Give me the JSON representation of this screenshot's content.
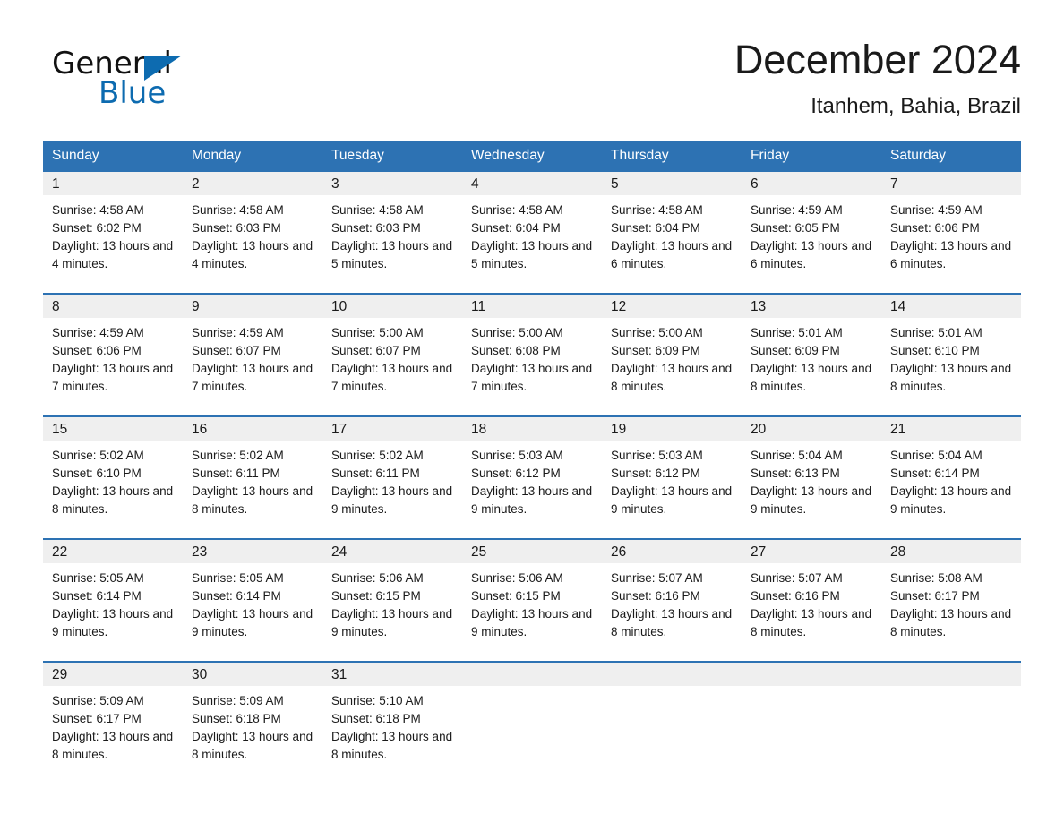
{
  "brand": {
    "logo_primary": "General",
    "logo_secondary": "Blue",
    "logo_triangle_icon": "triangle-icon",
    "accent_color": "#0d6bb0"
  },
  "header": {
    "title": "December 2024",
    "location": "Itanhem, Bahia, Brazil"
  },
  "calendar": {
    "header_color": "#2d72b3",
    "day_band_color": "#efefef",
    "weekdays": [
      "Sunday",
      "Monday",
      "Tuesday",
      "Wednesday",
      "Thursday",
      "Friday",
      "Saturday"
    ],
    "weeks": [
      [
        {
          "day": "1",
          "sunrise": "Sunrise: 4:58 AM",
          "sunset": "Sunset: 6:02 PM",
          "daylight": "Daylight: 13 hours and 4 minutes."
        },
        {
          "day": "2",
          "sunrise": "Sunrise: 4:58 AM",
          "sunset": "Sunset: 6:03 PM",
          "daylight": "Daylight: 13 hours and 4 minutes."
        },
        {
          "day": "3",
          "sunrise": "Sunrise: 4:58 AM",
          "sunset": "Sunset: 6:03 PM",
          "daylight": "Daylight: 13 hours and 5 minutes."
        },
        {
          "day": "4",
          "sunrise": "Sunrise: 4:58 AM",
          "sunset": "Sunset: 6:04 PM",
          "daylight": "Daylight: 13 hours and 5 minutes."
        },
        {
          "day": "5",
          "sunrise": "Sunrise: 4:58 AM",
          "sunset": "Sunset: 6:04 PM",
          "daylight": "Daylight: 13 hours and 6 minutes."
        },
        {
          "day": "6",
          "sunrise": "Sunrise: 4:59 AM",
          "sunset": "Sunset: 6:05 PM",
          "daylight": "Daylight: 13 hours and 6 minutes."
        },
        {
          "day": "7",
          "sunrise": "Sunrise: 4:59 AM",
          "sunset": "Sunset: 6:06 PM",
          "daylight": "Daylight: 13 hours and 6 minutes."
        }
      ],
      [
        {
          "day": "8",
          "sunrise": "Sunrise: 4:59 AM",
          "sunset": "Sunset: 6:06 PM",
          "daylight": "Daylight: 13 hours and 7 minutes."
        },
        {
          "day": "9",
          "sunrise": "Sunrise: 4:59 AM",
          "sunset": "Sunset: 6:07 PM",
          "daylight": "Daylight: 13 hours and 7 minutes."
        },
        {
          "day": "10",
          "sunrise": "Sunrise: 5:00 AM",
          "sunset": "Sunset: 6:07 PM",
          "daylight": "Daylight: 13 hours and 7 minutes."
        },
        {
          "day": "11",
          "sunrise": "Sunrise: 5:00 AM",
          "sunset": "Sunset: 6:08 PM",
          "daylight": "Daylight: 13 hours and 7 minutes."
        },
        {
          "day": "12",
          "sunrise": "Sunrise: 5:00 AM",
          "sunset": "Sunset: 6:09 PM",
          "daylight": "Daylight: 13 hours and 8 minutes."
        },
        {
          "day": "13",
          "sunrise": "Sunrise: 5:01 AM",
          "sunset": "Sunset: 6:09 PM",
          "daylight": "Daylight: 13 hours and 8 minutes."
        },
        {
          "day": "14",
          "sunrise": "Sunrise: 5:01 AM",
          "sunset": "Sunset: 6:10 PM",
          "daylight": "Daylight: 13 hours and 8 minutes."
        }
      ],
      [
        {
          "day": "15",
          "sunrise": "Sunrise: 5:02 AM",
          "sunset": "Sunset: 6:10 PM",
          "daylight": "Daylight: 13 hours and 8 minutes."
        },
        {
          "day": "16",
          "sunrise": "Sunrise: 5:02 AM",
          "sunset": "Sunset: 6:11 PM",
          "daylight": "Daylight: 13 hours and 8 minutes."
        },
        {
          "day": "17",
          "sunrise": "Sunrise: 5:02 AM",
          "sunset": "Sunset: 6:11 PM",
          "daylight": "Daylight: 13 hours and 9 minutes."
        },
        {
          "day": "18",
          "sunrise": "Sunrise: 5:03 AM",
          "sunset": "Sunset: 6:12 PM",
          "daylight": "Daylight: 13 hours and 9 minutes."
        },
        {
          "day": "19",
          "sunrise": "Sunrise: 5:03 AM",
          "sunset": "Sunset: 6:12 PM",
          "daylight": "Daylight: 13 hours and 9 minutes."
        },
        {
          "day": "20",
          "sunrise": "Sunrise: 5:04 AM",
          "sunset": "Sunset: 6:13 PM",
          "daylight": "Daylight: 13 hours and 9 minutes."
        },
        {
          "day": "21",
          "sunrise": "Sunrise: 5:04 AM",
          "sunset": "Sunset: 6:14 PM",
          "daylight": "Daylight: 13 hours and 9 minutes."
        }
      ],
      [
        {
          "day": "22",
          "sunrise": "Sunrise: 5:05 AM",
          "sunset": "Sunset: 6:14 PM",
          "daylight": "Daylight: 13 hours and 9 minutes."
        },
        {
          "day": "23",
          "sunrise": "Sunrise: 5:05 AM",
          "sunset": "Sunset: 6:14 PM",
          "daylight": "Daylight: 13 hours and 9 minutes."
        },
        {
          "day": "24",
          "sunrise": "Sunrise: 5:06 AM",
          "sunset": "Sunset: 6:15 PM",
          "daylight": "Daylight: 13 hours and 9 minutes."
        },
        {
          "day": "25",
          "sunrise": "Sunrise: 5:06 AM",
          "sunset": "Sunset: 6:15 PM",
          "daylight": "Daylight: 13 hours and 9 minutes."
        },
        {
          "day": "26",
          "sunrise": "Sunrise: 5:07 AM",
          "sunset": "Sunset: 6:16 PM",
          "daylight": "Daylight: 13 hours and 8 minutes."
        },
        {
          "day": "27",
          "sunrise": "Sunrise: 5:07 AM",
          "sunset": "Sunset: 6:16 PM",
          "daylight": "Daylight: 13 hours and 8 minutes."
        },
        {
          "day": "28",
          "sunrise": "Sunrise: 5:08 AM",
          "sunset": "Sunset: 6:17 PM",
          "daylight": "Daylight: 13 hours and 8 minutes."
        }
      ],
      [
        {
          "day": "29",
          "sunrise": "Sunrise: 5:09 AM",
          "sunset": "Sunset: 6:17 PM",
          "daylight": "Daylight: 13 hours and 8 minutes."
        },
        {
          "day": "30",
          "sunrise": "Sunrise: 5:09 AM",
          "sunset": "Sunset: 6:18 PM",
          "daylight": "Daylight: 13 hours and 8 minutes."
        },
        {
          "day": "31",
          "sunrise": "Sunrise: 5:10 AM",
          "sunset": "Sunset: 6:18 PM",
          "daylight": "Daylight: 13 hours and 8 minutes."
        },
        {
          "day": "",
          "sunrise": "",
          "sunset": "",
          "daylight": ""
        },
        {
          "day": "",
          "sunrise": "",
          "sunset": "",
          "daylight": ""
        },
        {
          "day": "",
          "sunrise": "",
          "sunset": "",
          "daylight": ""
        },
        {
          "day": "",
          "sunrise": "",
          "sunset": "",
          "daylight": ""
        }
      ]
    ]
  }
}
